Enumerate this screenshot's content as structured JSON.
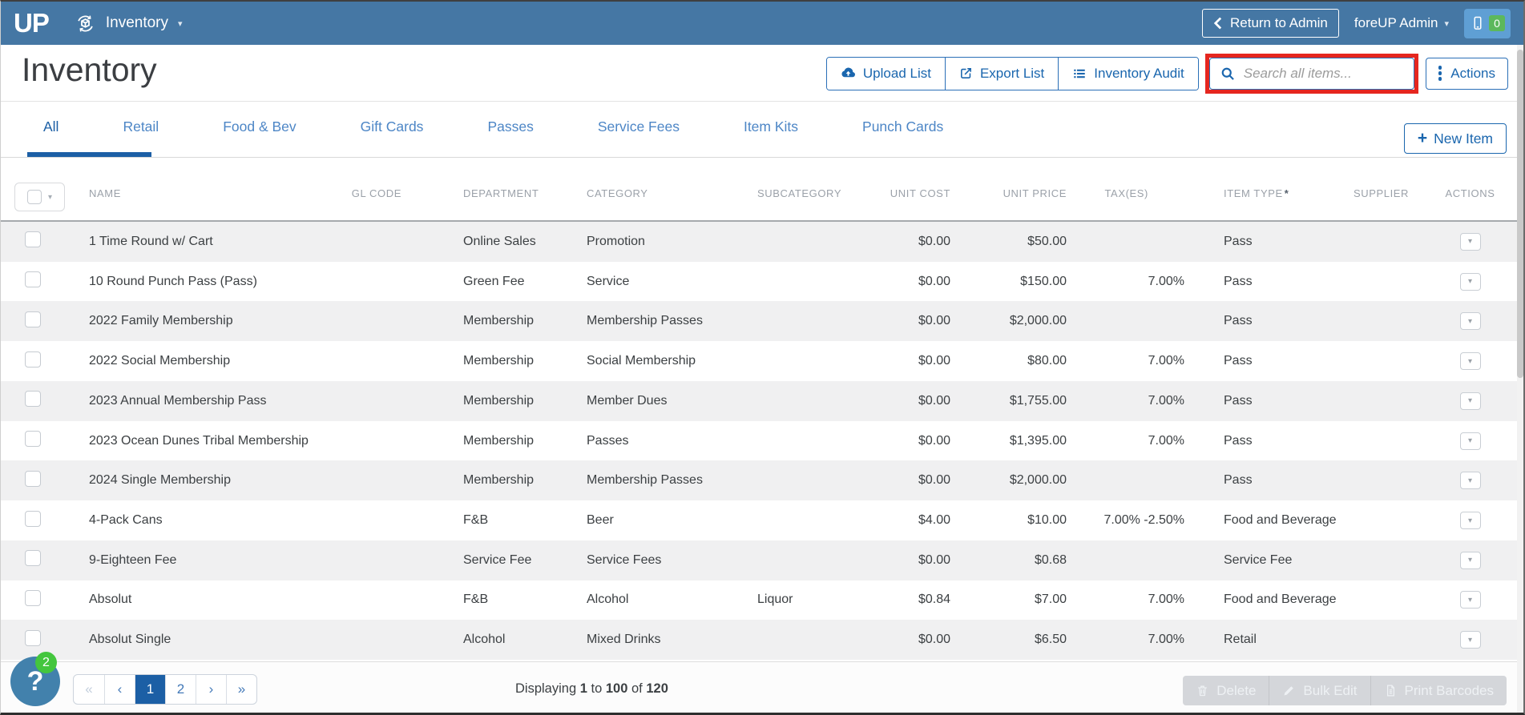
{
  "topbar": {
    "logo": "UP",
    "module": "Inventory",
    "return_to_admin": "Return to Admin",
    "user_menu": "foreUP Admin",
    "device_badge": "0"
  },
  "header": {
    "title": "Inventory",
    "upload": "Upload List",
    "export": "Export List",
    "audit": "Inventory Audit",
    "search_placeholder": "Search all items...",
    "actions": "Actions"
  },
  "tabs": {
    "items": [
      "All",
      "Retail",
      "Food & Bev",
      "Gift Cards",
      "Passes",
      "Service Fees",
      "Item Kits",
      "Punch Cards"
    ],
    "active": "All"
  },
  "new_item_label": "New Item",
  "table": {
    "columns": [
      "NAME",
      "GL CODE",
      "DEPARTMENT",
      "CATEGORY",
      "SUBCATEGORY",
      "UNIT COST",
      "UNIT PRICE",
      "TAX(ES)",
      "ITEM TYPE",
      "SUPPLIER",
      "ACTIONS"
    ],
    "item_type_required_mark": "*",
    "rows": [
      {
        "name": "1 Time Round w/ Cart",
        "gl": "",
        "dept": "Online Sales",
        "cat": "Promotion",
        "subcat": "",
        "cost": "$0.00",
        "price": "$50.00",
        "tax": "",
        "type": "Pass",
        "supplier": ""
      },
      {
        "name": "10 Round Punch Pass (Pass)",
        "gl": "",
        "dept": "Green Fee",
        "cat": "Service",
        "subcat": "",
        "cost": "$0.00",
        "price": "$150.00",
        "tax": "7.00%",
        "type": "Pass",
        "supplier": ""
      },
      {
        "name": "2022 Family Membership",
        "gl": "",
        "dept": "Membership",
        "cat": "Membership Passes",
        "subcat": "",
        "cost": "$0.00",
        "price": "$2,000.00",
        "tax": "",
        "type": "Pass",
        "supplier": ""
      },
      {
        "name": "2022 Social Membership",
        "gl": "",
        "dept": "Membership",
        "cat": "Social Membership",
        "subcat": "",
        "cost": "$0.00",
        "price": "$80.00",
        "tax": "7.00%",
        "type": "Pass",
        "supplier": ""
      },
      {
        "name": "2023 Annual Membership Pass",
        "gl": "",
        "dept": "Membership",
        "cat": "Member Dues",
        "subcat": "",
        "cost": "$0.00",
        "price": "$1,755.00",
        "tax": "7.00%",
        "type": "Pass",
        "supplier": ""
      },
      {
        "name": "2023 Ocean Dunes Tribal Membership",
        "gl": "",
        "dept": "Membership",
        "cat": "Passes",
        "subcat": "",
        "cost": "$0.00",
        "price": "$1,395.00",
        "tax": "7.00%",
        "type": "Pass",
        "supplier": ""
      },
      {
        "name": "2024 Single Membership",
        "gl": "",
        "dept": "Membership",
        "cat": "Membership Passes",
        "subcat": "",
        "cost": "$0.00",
        "price": "$2,000.00",
        "tax": "",
        "type": "Pass",
        "supplier": ""
      },
      {
        "name": "4-Pack Cans",
        "gl": "",
        "dept": "F&B",
        "cat": "Beer",
        "subcat": "",
        "cost": "$4.00",
        "price": "$10.00",
        "tax": "7.00% -2.50%",
        "type": "Food and Beverage",
        "supplier": ""
      },
      {
        "name": "9-Eighteen Fee",
        "gl": "",
        "dept": "Service Fee",
        "cat": "Service Fees",
        "subcat": "",
        "cost": "$0.00",
        "price": "$0.68",
        "tax": "",
        "type": "Service Fee",
        "supplier": ""
      },
      {
        "name": "Absolut",
        "gl": "",
        "dept": "F&B",
        "cat": "Alcohol",
        "subcat": "Liquor",
        "cost": "$0.84",
        "price": "$7.00",
        "tax": "7.00%",
        "type": "Food and Beverage",
        "supplier": ""
      },
      {
        "name": "Absolut Single",
        "gl": "",
        "dept": "Alcohol",
        "cat": "Mixed Drinks",
        "subcat": "",
        "cost": "$0.00",
        "price": "$6.50",
        "tax": "7.00%",
        "type": "Retail",
        "supplier": ""
      }
    ]
  },
  "footer": {
    "pagination": [
      {
        "label": "«",
        "state": "disabled"
      },
      {
        "label": "‹",
        "state": "normal"
      },
      {
        "label": "1",
        "state": "active"
      },
      {
        "label": "2",
        "state": "normal"
      },
      {
        "label": "›",
        "state": "normal"
      },
      {
        "label": "»",
        "state": "normal"
      }
    ],
    "displaying": {
      "prefix": "Displaying",
      "from": "1",
      "to_word": "to",
      "to": "100",
      "of_word": "of",
      "total": "120"
    },
    "bulk": [
      "Delete",
      "Bulk Edit",
      "Print Barcodes"
    ],
    "help_badge": "2"
  },
  "glyphs": {
    "caret_down": "▾",
    "plus": "+",
    "question_mark": "?"
  },
  "colors": {
    "topbar_blue": "#4577a4",
    "accent_blue": "#1a66ae",
    "active_tab_blue": "#1c5fa5",
    "annotation_red": "#e5261f",
    "badge_green": "#5cb85c",
    "help_badge_green": "#44c63e",
    "row_alt_gray": "#f0f0f1"
  }
}
